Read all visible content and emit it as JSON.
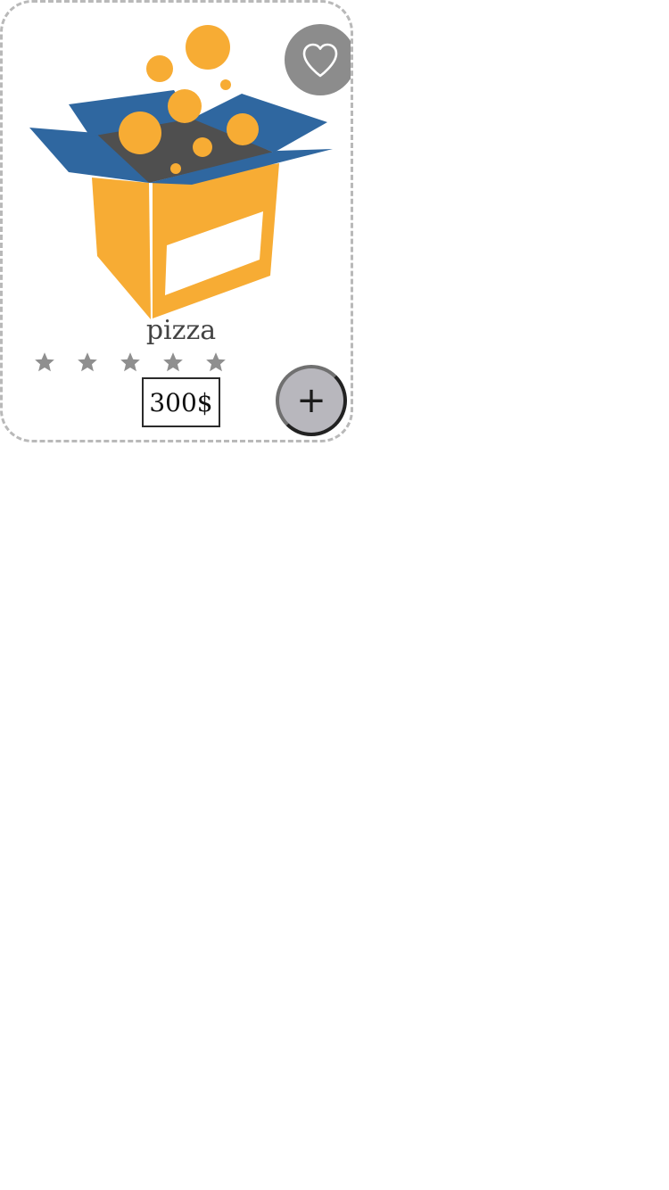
{
  "product": {
    "name": "pizza",
    "price": "300$",
    "image_icon": "open-box-with-bubbles-icon",
    "rating_stars": 5,
    "rating_filled": 0
  },
  "actions": {
    "favorite_icon": "heart-outline-icon",
    "add_label": "+"
  },
  "colors": {
    "box_orange": "#F7AC34",
    "box_blue": "#2F67A0",
    "box_inside": "#4F4F4F",
    "star_gray": "#8F8F8F",
    "favorite_bg": "#8C8C8C",
    "add_bg": "#B8B7BD",
    "card_border": "#B9B9B9"
  }
}
